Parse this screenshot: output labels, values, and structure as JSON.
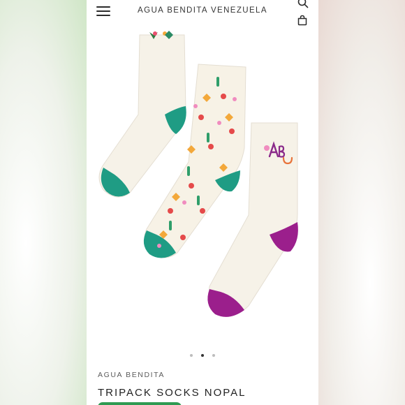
{
  "header": {
    "brand": "AGUA BENDITA VENEZUELA",
    "menu_icon": "hamburger-menu-icon",
    "search_icon": "search-icon",
    "bag_icon": "shopping-bag-icon"
  },
  "gallery": {
    "image": "three-socks-product-photo",
    "dots_count": 3,
    "active_index": 1
  },
  "product": {
    "vendor": "AGUA BENDITA",
    "title": "TRIPACK SOCKS NOPAL"
  },
  "colors": {
    "teal": "#1f9c84",
    "magenta": "#9b1f8c",
    "cream": "#f6f2e8",
    "cta_green": "#2f9a52"
  }
}
